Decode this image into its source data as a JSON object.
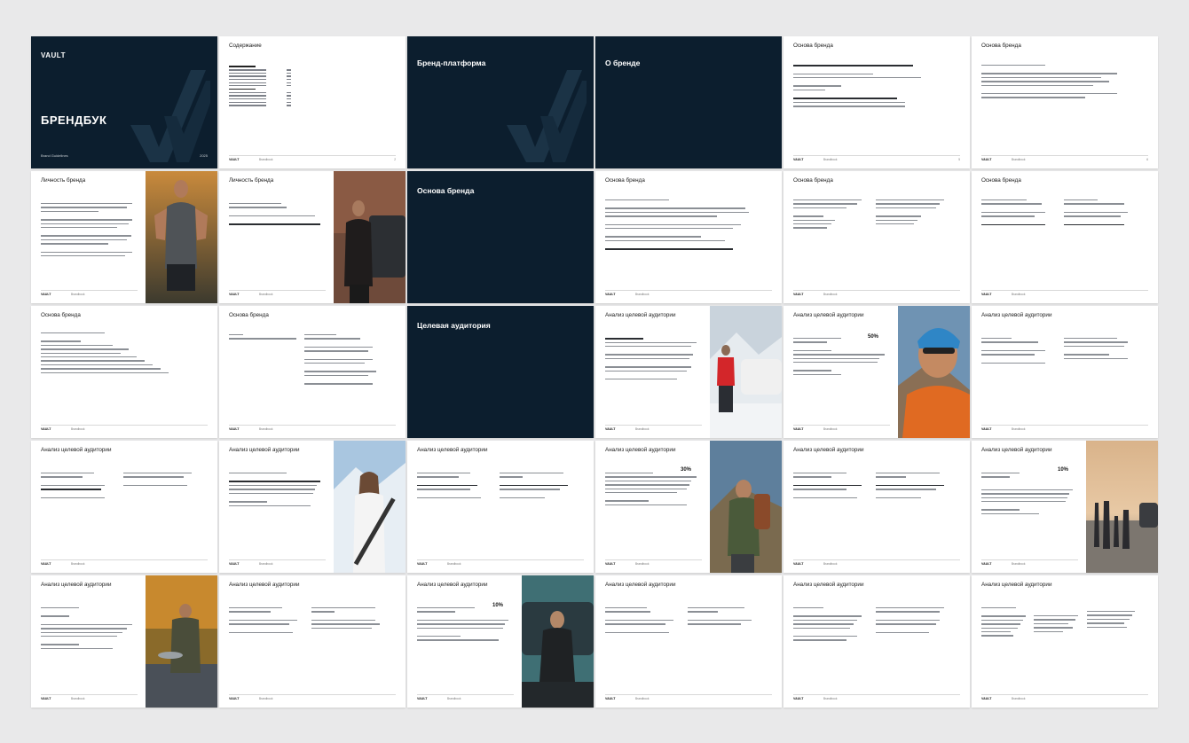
{
  "cover": {
    "logo": "VAULT",
    "title": "БРЕНДБУК",
    "subtitle": "Brand Guidelines",
    "year": "2025"
  },
  "footer": {
    "logo": "VAULT",
    "label": "Brandbook"
  },
  "slides": {
    "s2": {
      "title": "Содержание"
    },
    "s3": {
      "title": "Бренд-платформа"
    },
    "s4": {
      "title": "О бренде"
    },
    "s5": {
      "title": "Основа бренда"
    },
    "s6": {
      "title": "Основа бренда"
    },
    "s7": {
      "title": "Личность бренда"
    },
    "s8": {
      "title": "Личность бренда"
    },
    "s9": {
      "title": "Основа бренда"
    },
    "s10": {
      "title": "Основа бренда"
    },
    "s11": {
      "title": "Основа бренда"
    },
    "s12": {
      "title": "Основа бренда"
    },
    "s13": {
      "title": "Основа бренда"
    },
    "s14": {
      "title": "Основа бренда"
    },
    "s15": {
      "title": "Целевая аудитория"
    },
    "s16": {
      "title": "Анализ целевой аудитории"
    },
    "s17": {
      "title": "Анализ целевой аудитории",
      "pct": "50%"
    },
    "s18": {
      "title": "Анализ целевой аудитории"
    },
    "s19": {
      "title": "Анализ целевой аудитории"
    },
    "s20": {
      "title": "Анализ целевой аудитории"
    },
    "s21": {
      "title": "Анализ целевой аудитории"
    },
    "s22": {
      "title": "Анализ целевой аудитории",
      "pct": "30%"
    },
    "s23": {
      "title": "Анализ целевой аудитории"
    },
    "s24": {
      "title": "Анализ целевой аудитории",
      "pct": "10%"
    },
    "s25": {
      "title": "Анализ целевой аудитории"
    },
    "s26": {
      "title": "Анализ целевой аудитории"
    },
    "s27": {
      "title": "Анализ целевой аудитории",
      "pct": "10%"
    },
    "s28": {
      "title": "Анализ целевой аудитории"
    },
    "s29": {
      "title": "Анализ целевой аудитории"
    },
    "s30": {
      "title": "Анализ целевой аудитории"
    }
  },
  "colors": {
    "navy": "#0c1e2e",
    "page": "#ffffff",
    "background": "#e9e9ea"
  }
}
